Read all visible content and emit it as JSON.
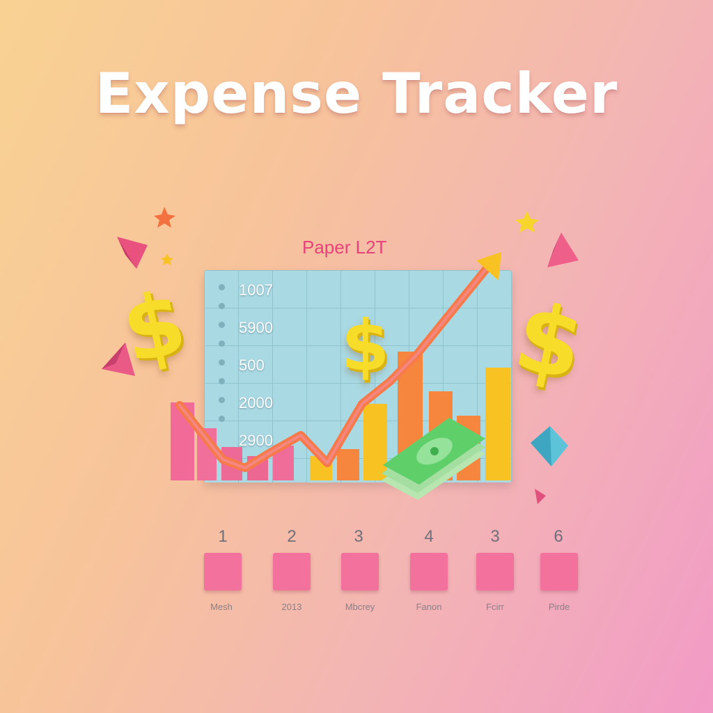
{
  "title": "Expense Tracker",
  "chart": {
    "subtitle": "Paper L2T",
    "y_labels": [
      "1007",
      "5900",
      "500",
      "2000",
      "2900"
    ]
  },
  "steps": [
    {
      "number": "1",
      "label": "Mesh"
    },
    {
      "number": "2",
      "label": "2013"
    },
    {
      "number": "3",
      "label": "Mbcrey"
    },
    {
      "number": "4",
      "label": "Fanon"
    },
    {
      "number": "3",
      "label": "Fcirr"
    },
    {
      "number": "6",
      "label": "Pirde"
    }
  ],
  "icons": [
    "dollar-sign-icon",
    "money-stack-icon",
    "trend-arrow-icon",
    "star-icon",
    "gem-icon"
  ],
  "colors": {
    "title": "#ffffff",
    "subtitle": "#e8427a",
    "grid": "#a9d9e3",
    "pink": "#f2729d",
    "yellow": "#f8c322",
    "orange": "#f6863d",
    "dollar": "#f8dc2a",
    "money": "#5fcf6a"
  }
}
